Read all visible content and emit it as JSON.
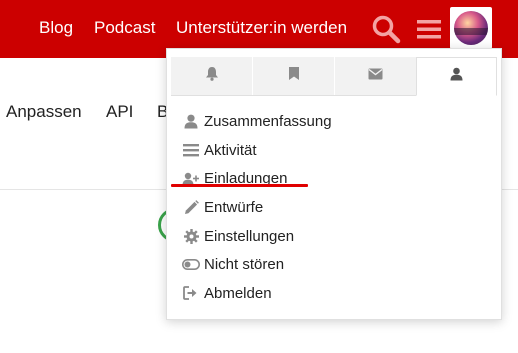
{
  "header": {
    "nav": [
      {
        "label": "Blog"
      },
      {
        "label": "Podcast"
      },
      {
        "label": "Unterstützer:in werden"
      }
    ]
  },
  "page": {
    "links": [
      {
        "label": "Anpassen"
      },
      {
        "label": "API"
      },
      {
        "label": "B"
      }
    ]
  },
  "user_menu": {
    "tabs": [
      {
        "icon": "bell-icon"
      },
      {
        "icon": "bookmark-icon"
      },
      {
        "icon": "envelope-icon"
      },
      {
        "icon": "user-icon",
        "active": true
      }
    ],
    "items": [
      {
        "label": "Zusammenfassung",
        "icon": "user-icon"
      },
      {
        "label": "Aktivität",
        "icon": "stream-icon"
      },
      {
        "label": "Einladungen",
        "icon": "user-plus-icon"
      },
      {
        "label": "Entwürfe",
        "icon": "pencil-icon"
      },
      {
        "label": "Einstellungen",
        "icon": "gear-icon"
      },
      {
        "label": "Nicht stören",
        "icon": "toggle-icon"
      },
      {
        "label": "Abmelden",
        "icon": "sign-out-icon"
      }
    ]
  },
  "colors": {
    "header_bg": "#cc0000",
    "highlight_underline": "#e00000",
    "icon_gray": "#888888"
  }
}
